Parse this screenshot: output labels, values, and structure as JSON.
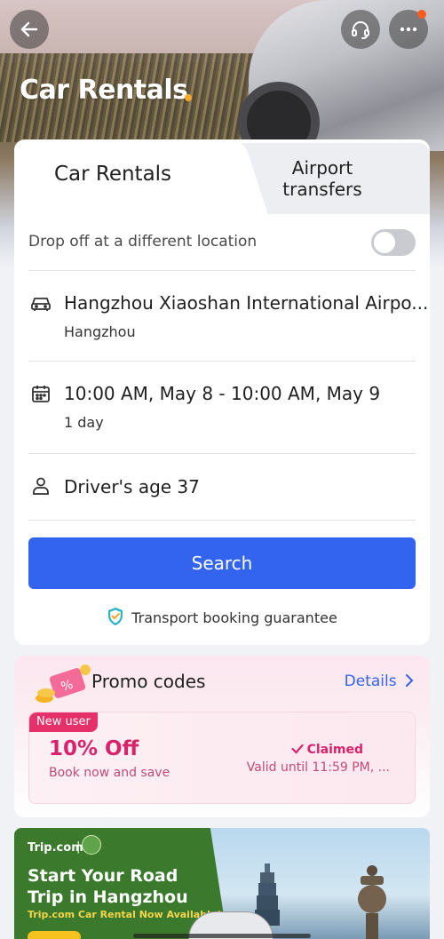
{
  "header": {
    "title": "Car Rentals"
  },
  "tabs": [
    {
      "label": "Car Rentals",
      "active": true
    },
    {
      "label": "Airport transfers",
      "line1": "Airport",
      "line2": "transfers",
      "active": false
    }
  ],
  "form": {
    "dropoff_label": "Drop off at a different location",
    "dropoff_enabled": false,
    "location": {
      "name": "Hangzhou Xiaoshan International Airpo...",
      "city": "Hangzhou"
    },
    "dates": {
      "range": "10:00 AM, May 8 - 10:00 AM, May 9",
      "duration": "1 day"
    },
    "driver_age": "Driver's age 37",
    "search_label": "Search",
    "guarantee": "Transport booking guarantee"
  },
  "promo": {
    "title": "Promo codes",
    "details_label": "Details",
    "coupon": {
      "badge": "New user",
      "discount": "10% Off",
      "subtitle": "Book now and save",
      "status": "Claimed",
      "validity": "Valid until 11:59 PM, ..."
    }
  },
  "banner": {
    "brand": "Trip.com",
    "headline_line1": "Start Your Road",
    "headline_line2": "Trip in Hangzhou",
    "subline": "Trip.com Car Rental Now Available!"
  },
  "colors": {
    "accent": "#3264f0",
    "promo_pink": "#d8236a",
    "dot_orange": "#f7a928"
  }
}
